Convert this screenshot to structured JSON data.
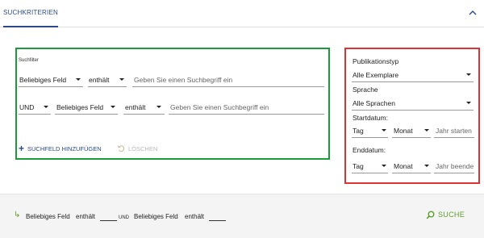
{
  "tabs": {
    "criteria_label": "SUCHKRITERIEN"
  },
  "filter": {
    "heading": "Suchfilter",
    "row1": {
      "field": "Beliebiges Feld",
      "operator": "enthält",
      "placeholder": "Geben Sie einen Suchbegriff ein"
    },
    "row2": {
      "bool": "UND",
      "field": "Beliebiges Feld",
      "operator": "enthält",
      "placeholder": "Geben Sie einen Suchbegriff ein"
    },
    "add_label": "SUCHFELD HINZUFÜGEN",
    "delete_label": "LÖSCHEN"
  },
  "facets": {
    "pubtype_label": "Publikationstyp",
    "pubtype_value": "Alle Exemplare",
    "language_label": "Sprache",
    "language_value": "Alle Sprachen",
    "start_label": "Startdatum:",
    "start_day": "Tag",
    "start_month": "Monat",
    "start_year_placeholder": "Jahr starten",
    "end_label": "Enddatum:",
    "end_day": "Tag",
    "end_month": "Monat",
    "end_year_placeholder": "Jahr beende"
  },
  "summary": {
    "field1": "Beliebiges Feld",
    "op1": "enthält",
    "joiner": "UND",
    "field2": "Beliebiges Feld",
    "op2": "enthält"
  },
  "search_label": "SUCHE",
  "colors": {
    "accent_blue": "#2a4a8c",
    "green": "#5a9e2a",
    "outline_green": "#1c9b3a",
    "outline_red": "#e03232"
  }
}
